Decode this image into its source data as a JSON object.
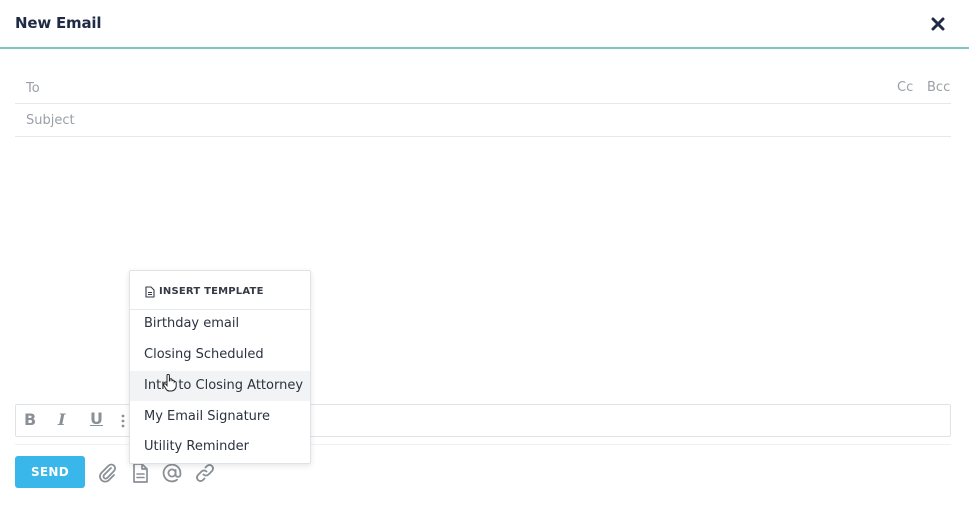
{
  "window": {
    "title": "New Email"
  },
  "compose": {
    "to_placeholder": "To",
    "subject_placeholder": "Subject",
    "cc_label": "Cc",
    "bcc_label": "Bcc"
  },
  "toolbar": {
    "bold": "B",
    "italic": "I",
    "underline": "U"
  },
  "actions": {
    "send_label": "SEND"
  },
  "template_menu": {
    "header": "INSERT TEMPLATE",
    "items": [
      {
        "label": "Birthday email"
      },
      {
        "label": "Closing Scheduled"
      },
      {
        "label": "Intro to Closing Attorney"
      },
      {
        "label": "My Email Signature"
      },
      {
        "label": "Utility Reminder"
      }
    ],
    "hovered_index": 2
  },
  "colors": {
    "accent": "#39b6ea",
    "header_border": "#7cc7c3",
    "title": "#1f2a44"
  },
  "icons": {
    "close": "close-icon",
    "list": "bullet-list-icon",
    "attach": "paperclip-icon",
    "template": "document-icon",
    "mention": "at-sign-icon",
    "link": "link-icon"
  }
}
